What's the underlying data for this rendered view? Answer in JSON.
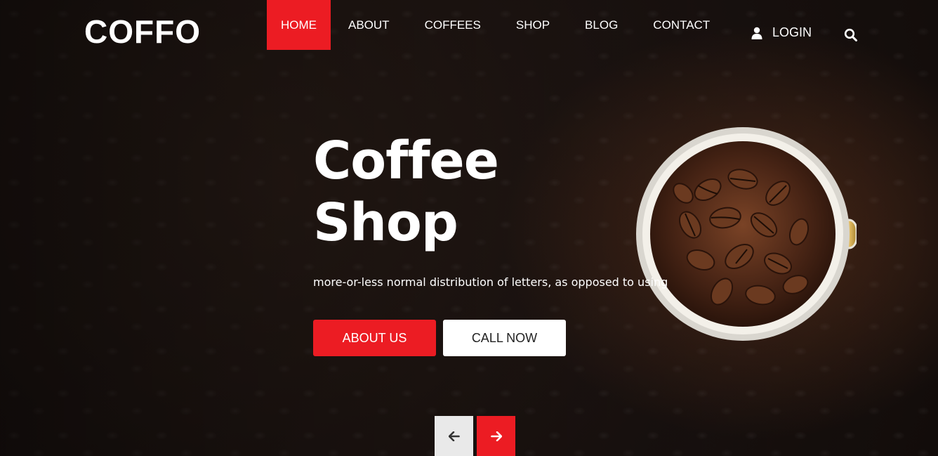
{
  "brand": {
    "logo": "COFFO"
  },
  "nav": {
    "items": [
      {
        "label": "HOME",
        "active": true
      },
      {
        "label": "ABOUT"
      },
      {
        "label": "COFFEES"
      },
      {
        "label": "SHOP"
      },
      {
        "label": "BLOG"
      },
      {
        "label": "CONTACT"
      }
    ],
    "login_label": "LOGIN",
    "login_icon": "user-icon",
    "search_icon": "search-icon"
  },
  "hero": {
    "title_line1": "Coffee",
    "title_line2": "Shop",
    "subtitle": "more-or-less normal distribution of letters, as opposed to using",
    "primary_button": "ABOUT US",
    "secondary_button": "CALL NOW"
  },
  "carousel": {
    "prev_icon": "arrow-left-icon",
    "next_icon": "arrow-right-icon"
  },
  "colors": {
    "accent": "#ec1c23",
    "text": "#ffffff",
    "background": "#1b1310"
  }
}
